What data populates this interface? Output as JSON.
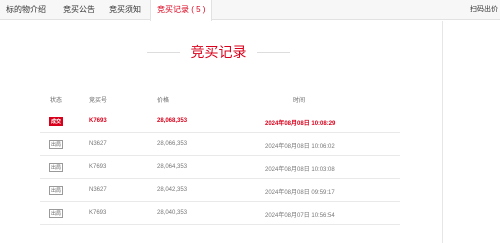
{
  "tabs": [
    "标的物介绍",
    "竞买公告",
    "竞买须知",
    "竞买记录 ( 5 )"
  ],
  "tab_right": "扫码出价",
  "section_title": "竞买记录",
  "table": {
    "headers": [
      "状态",
      "竞买号",
      "价格",
      "时间"
    ],
    "rows": [
      {
        "status": "成交",
        "bidder": "K7693",
        "price": "28,068,353",
        "time": "2024年08月08日 10:08:29",
        "winner": true
      },
      {
        "status": "出局",
        "bidder": "N3627",
        "price": "28,066,353",
        "time": "2024年08月08日 10:06:02",
        "winner": false
      },
      {
        "status": "出局",
        "bidder": "K7693",
        "price": "28,064,353",
        "time": "2024年08月08日 10:03:08",
        "winner": false
      },
      {
        "status": "出局",
        "bidder": "N3627",
        "price": "28,042,353",
        "time": "2024年08月08日 09:59:17",
        "winner": false
      },
      {
        "status": "出局",
        "bidder": "K7693",
        "price": "28,040,353",
        "time": "2024年08月07日 10:56:54",
        "winner": false
      }
    ]
  },
  "colors": {
    "accent": "#d9001b"
  }
}
